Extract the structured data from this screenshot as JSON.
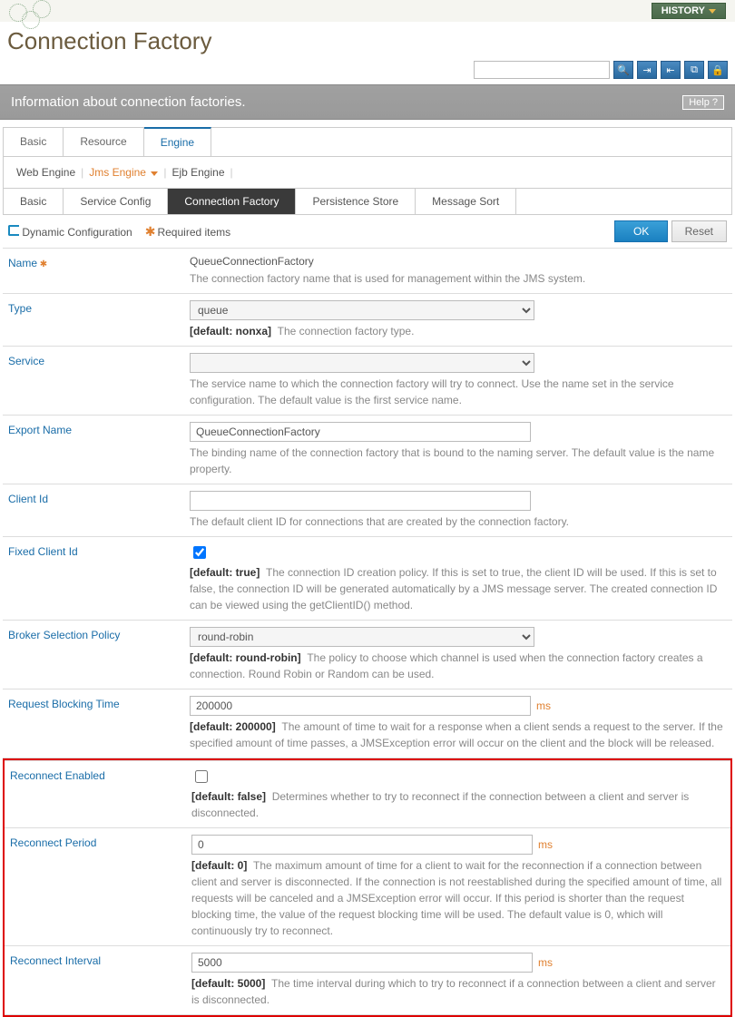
{
  "history_label": "HISTORY",
  "page_title": "Connection Factory",
  "info_bar": "Information about connection factories.",
  "help_label": "Help  ?",
  "tabs1": {
    "basic": "Basic",
    "resource": "Resource",
    "engine": "Engine"
  },
  "subtabs": {
    "web": "Web Engine",
    "jms": "Jms Engine",
    "ejb": "Ejb Engine"
  },
  "tabs3": {
    "basic": "Basic",
    "service": "Service Config",
    "cf": "Connection Factory",
    "ps": "Persistence Store",
    "ms": "Message Sort"
  },
  "legend": {
    "dyn": "Dynamic Configuration",
    "req": "Required items"
  },
  "buttons": {
    "ok": "OK",
    "reset": "Reset"
  },
  "rows": {
    "name": {
      "label": "Name",
      "value": "QueueConnectionFactory",
      "desc": "The connection factory name that is used for management within the JMS system."
    },
    "type": {
      "label": "Type",
      "value": "queue",
      "default": "[default: nonxa]",
      "desc": "The connection factory type."
    },
    "service": {
      "label": "Service",
      "value": "",
      "desc": "The service name to which the connection factory will try to connect. Use the name set in the service configuration. The default value is the first service name."
    },
    "export": {
      "label": "Export Name",
      "value": "QueueConnectionFactory",
      "desc": "The binding name of the connection factory that is bound to the naming server. The default value is the name property."
    },
    "clientid": {
      "label": "Client Id",
      "value": "",
      "desc": "The default client ID for connections that are created by the connection factory."
    },
    "fixedclientid": {
      "label": "Fixed Client Id",
      "checked": true,
      "default": "[default: true]",
      "desc": "The connection ID creation policy. If this is set to true, the client ID will be used. If this is set to false, the connection ID will be generated automatically by a JMS message server. The created connection ID can be viewed using the getClientID() method."
    },
    "broker": {
      "label": "Broker Selection Policy",
      "value": "round-robin",
      "default": "[default: round-robin]",
      "desc": "The policy to choose which channel is used when the connection factory creates a connection. Round Robin or Random can be used."
    },
    "reqblock": {
      "label": "Request Blocking Time",
      "value": "200000",
      "unit": "ms",
      "default": "[default: 200000]",
      "desc": "The amount of time to wait for a response when a client sends a request to the server. If the specified amount of time passes, a JMSException error will occur on the client and the block will be released."
    },
    "reconenabled": {
      "label": "Reconnect Enabled",
      "checked": false,
      "default": "[default: false]",
      "desc": "Determines whether to try to reconnect if the connection between a client and server is disconnected."
    },
    "reconperiod": {
      "label": "Reconnect Period",
      "value": "0",
      "unit": "ms",
      "default": "[default: 0]",
      "desc": "The maximum amount of time for a client to wait for the reconnection if a connection between client and server is disconnected. If the connection is not reestablished during the specified amount of time, all requests will be canceled and a JMSException error will occur. If this period is shorter than the request blocking time, the value of the request blocking time will be used. The default value is 0, which will continuously try to reconnect."
    },
    "reconinterval": {
      "label": "Reconnect Interval",
      "value": "5000",
      "unit": "ms",
      "default": "[default: 5000]",
      "desc": "The time interval during which to try to reconnect if a connection between a client and server is disconnected."
    }
  }
}
